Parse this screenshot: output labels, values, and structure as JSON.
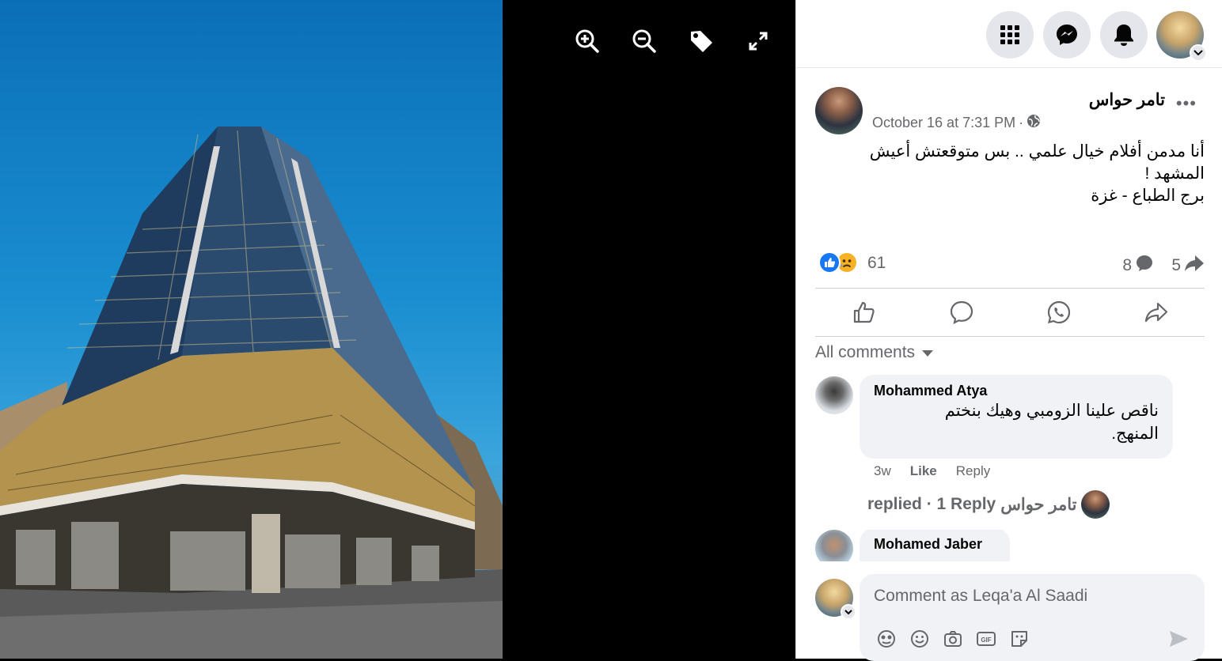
{
  "viewer": {
    "tools": [
      {
        "name": "zoom-in-icon"
      },
      {
        "name": "zoom-out-icon"
      },
      {
        "name": "tag-icon"
      },
      {
        "name": "fullscreen-icon"
      }
    ]
  },
  "topbar": {
    "icons": [
      "apps-grid-icon",
      "messenger-icon",
      "notifications-bell-icon",
      "account-avatar"
    ]
  },
  "post": {
    "author": "تامر حواس",
    "more": "•••",
    "timestamp": "October 16 at 7:31 PM",
    "audience_separator": "·",
    "text_lines": "أنا مدمن أفلام خيال علمي .. بس متوقعتش أعيش\nالمشهد !\nبرج الطباع - غزة",
    "reaction_count": "61",
    "comment_count": "8",
    "share_count": "5"
  },
  "comments_filter": "All comments",
  "comments": [
    {
      "author": "Mohammed Atya",
      "text": "ناقص علينا الزومبي وهيك بنختم\nالمنهج.",
      "age": "3w",
      "like_label": "Like",
      "reply_label": "Reply"
    },
    {
      "author": "Mohamed Jaber",
      "text": ""
    }
  ],
  "replies_summary": {
    "replier": "تامر حواس",
    "text": "replied · 1 Reply"
  },
  "composer": {
    "placeholder": "Comment as Leqa'a Al Saadi"
  },
  "colors": {
    "accent": "#1877f2",
    "sad": "#f7b125",
    "muted": "#65676b",
    "bubble": "#f0f2f5"
  }
}
